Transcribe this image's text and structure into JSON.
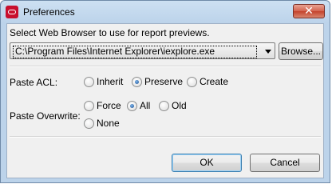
{
  "window": {
    "title": "Preferences",
    "close_glyph": "✕"
  },
  "browser": {
    "prompt": "Select Web Browser to use for report previews.",
    "path_value": "C:\\Program Files\\Internet Explorer\\iexplore.exe",
    "browse_label": "Browse..."
  },
  "paste_acl": {
    "label": "Paste ACL:",
    "options": [
      {
        "label": "Inherit",
        "checked": false
      },
      {
        "label": "Preserve",
        "checked": true
      },
      {
        "label": "Create",
        "checked": false
      }
    ]
  },
  "paste_overwrite": {
    "label": "Paste Overwrite:",
    "options": [
      {
        "label": "Force",
        "checked": false
      },
      {
        "label": "All",
        "checked": true
      },
      {
        "label": "Old",
        "checked": false
      },
      {
        "label": "None",
        "checked": false
      }
    ]
  },
  "footer": {
    "ok_label": "OK",
    "cancel_label": "Cancel"
  },
  "icons": {
    "app": "oracle-logo-icon",
    "dropdown": "chevron-down-icon",
    "close": "close-icon"
  }
}
